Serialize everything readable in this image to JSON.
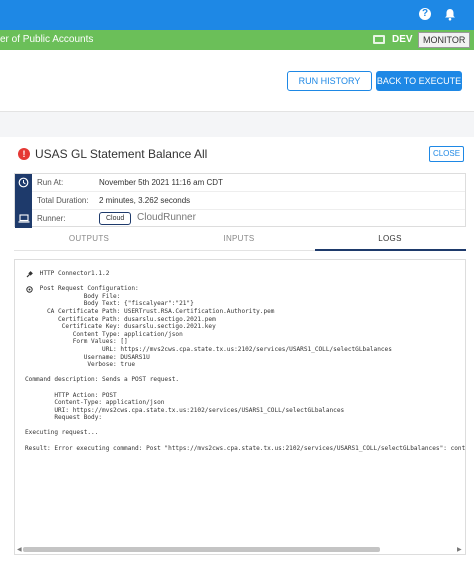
{
  "topbar": {
    "help_icon": "help-circle-icon",
    "notification_icon": "bell-icon"
  },
  "org_bar": {
    "org_name": "er of Public Accounts",
    "environment": "DEV",
    "monitor_label": "MONITOR",
    "screen_icon": "monitor-icon"
  },
  "header": {
    "run_history_label": "RUN HISTORY",
    "back_to_execute_label": "BACK TO EXECUTE"
  },
  "execution": {
    "title": "USAS GL Statement Balance All",
    "status_icon": "error-icon",
    "status_color": "#e53935",
    "close_label": "CLOSE",
    "info": [
      {
        "icon": "clock-icon",
        "label": "Run At:",
        "value": "November 5th 2021 11:16 am CDT"
      },
      {
        "icon": "",
        "label": "Total Duration:",
        "value": "2 minutes, 3.262 seconds"
      },
      {
        "icon": "laptop-icon",
        "label": "Runner:",
        "chip": "Cloud",
        "value": "CloudRunner"
      }
    ]
  },
  "tabs": [
    {
      "label": "OUTPUTS",
      "active": false
    },
    {
      "label": "INPUTS",
      "active": false
    },
    {
      "label": "LOGS",
      "active": true
    }
  ],
  "logs": {
    "text": "    HTTP Connector1.1.2\n\n    Post Request Configuration:\n                Body File:\n                Body Text: {\"fiscalyear\":\"21\"}\n      CA Certificate Path: USERTrust.RSA.Certification.Authority.pem\n         Certificate Path: dusarslu.sectigo.2021.pem\n          Certificate Key: dusarslu.sectigo.2021.key\n             Content Type: application/json\n             Form Values: []\n                     URL: https://mvs2cws.cpa.state.tx.us:2102/services/USARS1_COLL/selectGLbalances\n                Username: DUSARS1U\n                 Verbose: true\n\nCommand description: Sends a POST request.\n\n        HTTP Action: POST\n        Content-Type: application/json\n        URI: https://mvs2cws.cpa.state.tx.us:2102/services/USARS1_COLL/selectGLbalances\n        Request Body:\n\nExecuting request...\n\nResult: Error executing command: Post \"https://mvs2cws.cpa.state.tx.us:2102/services/USARS1_COLL/selectGLbalances\": context",
    "connector_icon": "plug-icon",
    "config_icon": "gear-icon"
  }
}
